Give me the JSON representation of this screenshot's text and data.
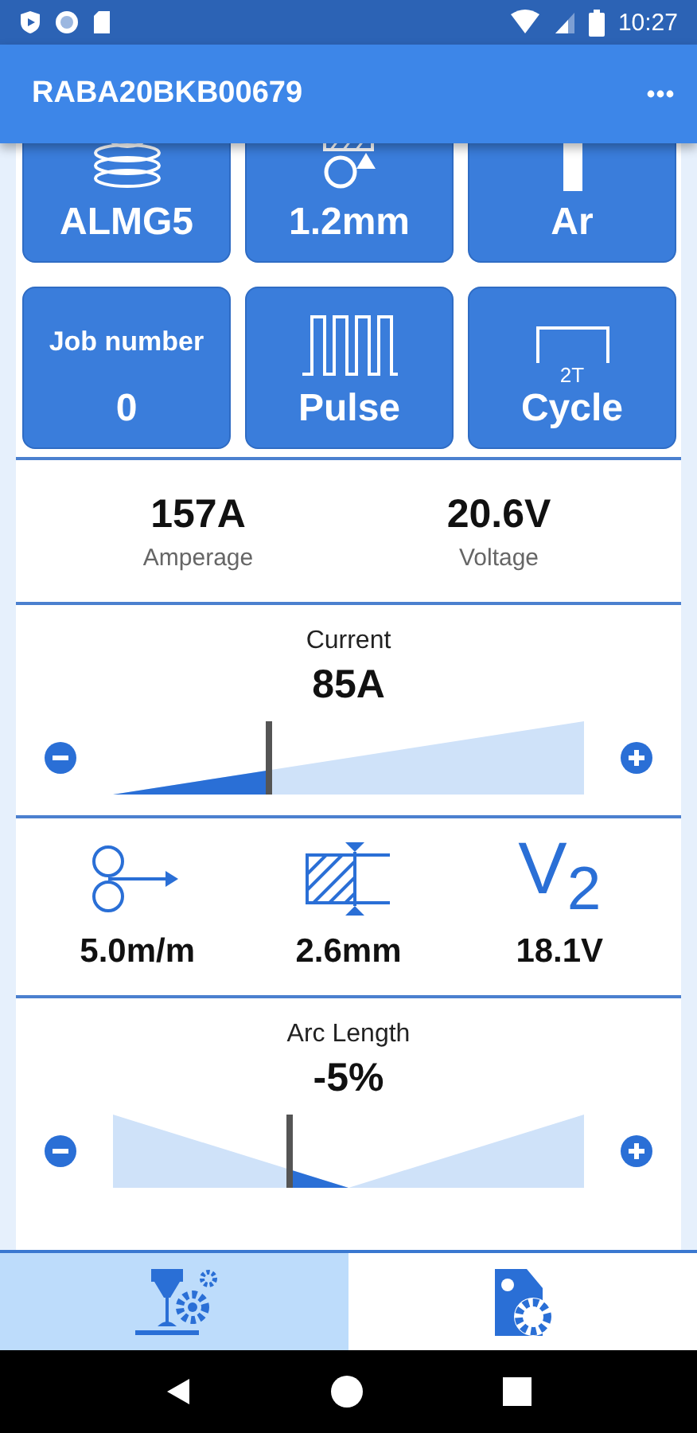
{
  "status_bar": {
    "time": "10:27"
  },
  "app_bar": {
    "title": "RABA20BKB00679"
  },
  "tiles": [
    {
      "kind": "spool",
      "value": "ALMG5"
    },
    {
      "kind": "wire",
      "value": "1.2mm"
    },
    {
      "kind": "gas",
      "value": "Ar"
    },
    {
      "kind": "label",
      "label": "Job number",
      "value": "0"
    },
    {
      "kind": "pulse",
      "value": "Pulse"
    },
    {
      "kind": "cycle",
      "badge": "2T",
      "value": "Cycle"
    }
  ],
  "readings": [
    {
      "value": "157A",
      "label": "Amperage"
    },
    {
      "value": "20.6V",
      "label": "Voltage"
    }
  ],
  "sliders_top": [
    {
      "kind": "ramp",
      "title": "Current",
      "value": "85A",
      "level": 0.33
    }
  ],
  "parameters": [
    {
      "kind": "wire_feed",
      "value": "5.0m/m"
    },
    {
      "kind": "thickness",
      "value": "2.6mm"
    },
    {
      "kind": "symbol",
      "symbol": "V$_{2}$",
      "value": "18.1V"
    }
  ],
  "sliders_bottom": [
    {
      "kind": "centered",
      "title": "Arc Length",
      "value": "-5%",
      "level": 0.375
    }
  ],
  "nav": [
    {
      "kind": "welding",
      "selected": true
    },
    {
      "kind": "job_settings",
      "selected": false
    }
  ]
}
